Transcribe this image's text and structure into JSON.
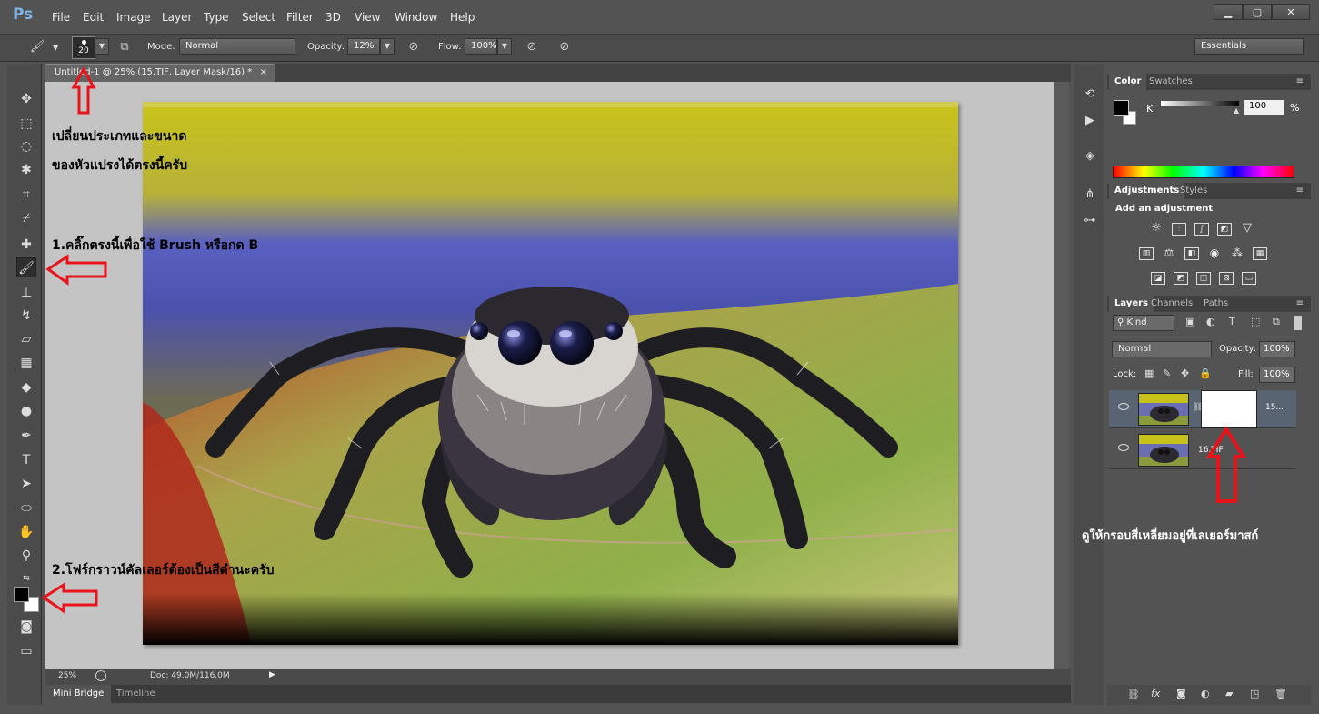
{
  "app": {
    "logo": "Ps"
  },
  "menu": [
    "File",
    "Edit",
    "Image",
    "Layer",
    "Type",
    "Select",
    "Filter",
    "3D",
    "View",
    "Window",
    "Help"
  ],
  "window_controls": {
    "minimize": "▁",
    "maximize": "▢",
    "close": "✕"
  },
  "options_bar": {
    "brush_size": "20",
    "mode_label": "Mode:",
    "mode_value": "Normal",
    "opacity_label": "Opacity:",
    "opacity_value": "12%",
    "flow_label": "Flow:",
    "flow_value": "100%",
    "workspace": "Essentials"
  },
  "document": {
    "tab_title": "Untitled-1 @ 25% (15.TIF, Layer Mask/16) *",
    "zoom": "25%",
    "doc_info": "Doc: 49.0M/116.0M"
  },
  "bottom_tabs": [
    "Mini Bridge",
    "Timeline"
  ],
  "color_panel": {
    "tabs": [
      "Color",
      "Swatches"
    ],
    "channel_label": "K",
    "channel_value": "100",
    "unit": "%"
  },
  "adjustments_panel": {
    "tabs": [
      "Adjustments",
      "Styles"
    ],
    "heading": "Add an adjustment"
  },
  "layers_panel": {
    "tabs": [
      "Layers",
      "Channels",
      "Paths"
    ],
    "filter_kind": "Kind",
    "blend_mode": "Normal",
    "opacity_label": "Opacity:",
    "opacity_value": "100%",
    "lock_label": "Lock:",
    "fill_label": "Fill:",
    "fill_value": "100%",
    "layers": [
      {
        "name": "15...",
        "has_mask": true,
        "selected": true
      },
      {
        "name": "16.TIF",
        "has_mask": false,
        "selected": false
      }
    ]
  },
  "annotations": {
    "brush_type_line1": "เปลี่ยนประเภทและขนาด",
    "brush_type_line2": "ของหัวแปรงได้ตรงนี้ครับ",
    "step1": "1.คลิ๊กตรงนี้เพื่อใช้   Brush หรือกด   B",
    "step2": "2.โฟร์กราวน์คัลเลอร์ต้องเป็นสีดำนะครับ",
    "mask_note": "ดูให้กรอบสี่เหลี่ยมอยู่ที่เลเยอร์มาสก์"
  },
  "colors": {
    "arrow": "#e8141c",
    "foreground": "#000000",
    "background": "#ffffff"
  }
}
